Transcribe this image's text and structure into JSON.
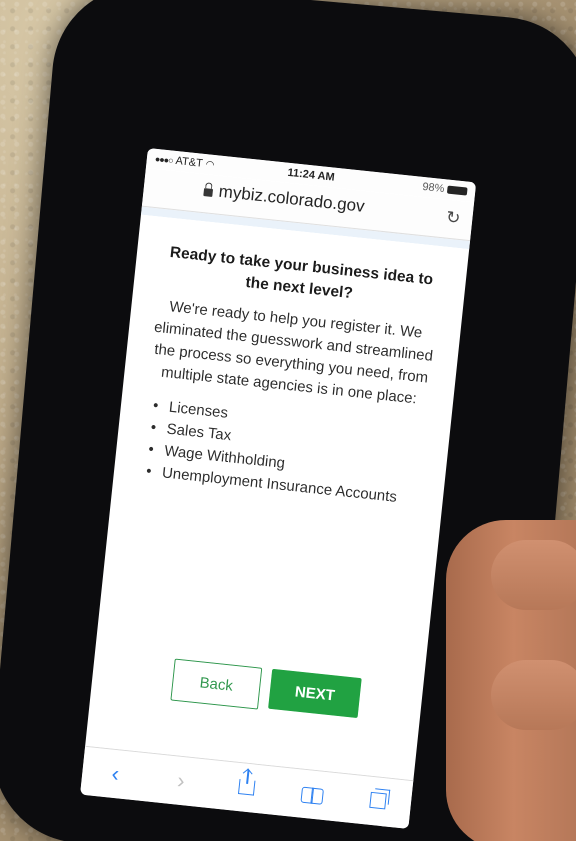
{
  "status_bar": {
    "carrier": "AT&T",
    "time": "11:24 AM",
    "battery": "98%"
  },
  "browser": {
    "url": "mybiz.colorado.gov"
  },
  "page": {
    "headline": "Ready to take your business idea to the next level?",
    "intro": "We're ready to help you register it. We eliminated the guesswork and streamlined the process so everything you need, from multiple state agencies is in one place:",
    "items": [
      "Licenses",
      "Sales Tax",
      "Wage Withholding",
      "Unemployment Insurance Accounts"
    ],
    "back_label": "Back",
    "next_label": "NEXT"
  },
  "toolbar": {
    "back_icon": "chevron-left-icon",
    "forward_icon": "chevron-right-icon",
    "share_icon": "share-icon",
    "bookmarks_icon": "book-icon",
    "tabs_icon": "tabs-icon"
  },
  "colors": {
    "accent_green": "#1f9a3f",
    "ios_blue": "#2c7be5"
  }
}
